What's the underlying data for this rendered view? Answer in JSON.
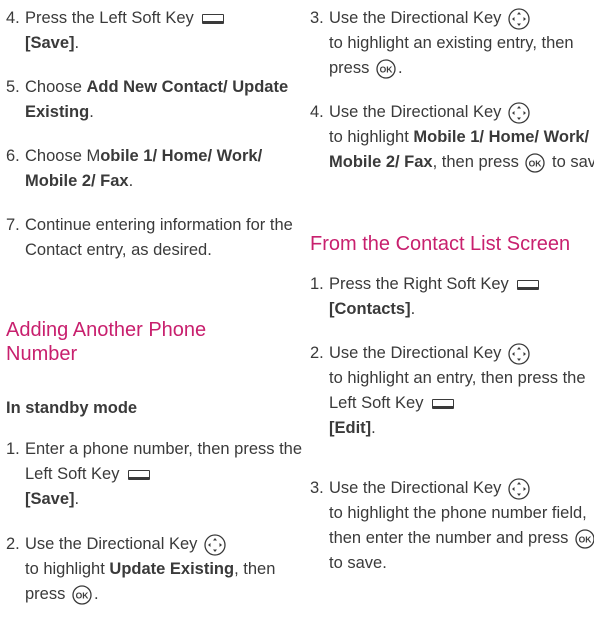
{
  "left": {
    "step4": {
      "num": "4.",
      "t1": "Press the Left Soft Key",
      "t2": "[Save]",
      "t3": "."
    },
    "step5": {
      "num": "5.",
      "t1": "Choose ",
      "t2": "Add New Contact/ Update Existing",
      "t3": "."
    },
    "step6": {
      "num": "6.",
      "t1": "Choose M",
      "t2": "obile 1/ Home/ Work/ Mobile 2/ Fax",
      "t3": "."
    },
    "step7": {
      "num": "7.",
      "t1": "Continue entering information for the Contact entry, as desired."
    },
    "heading": "Adding Another Phone Number",
    "subheading": "In standby mode",
    "a1": {
      "num": "1.",
      "t1": "Enter a phone number, then press the Left Soft Key",
      "t2": "[Save]",
      "t3": "."
    },
    "a2": {
      "num": "2.",
      "t1": "Use the Directional Key",
      "t2": "to highlight ",
      "t3": "Update Existing",
      "t4": ", then press",
      "t5": "."
    }
  },
  "right": {
    "s3": {
      "num": "3.",
      "t1": "Use the Directional Key",
      "t2": "to highlight an existing entry, then press",
      "t3": "."
    },
    "s4": {
      "num": "4.",
      "t1": "Use the Directional Key",
      "t2": "to highlight ",
      "t3": "Mobile 1/ Home/ Work/ Mobile 2/ Fax",
      "t4": ", then press",
      "t5": "to save."
    },
    "heading": "From the Contact List Screen",
    "b1": {
      "num": "1.",
      "t1": "Press the Right Soft Key",
      "t2": "[Contacts]",
      "t3": "."
    },
    "b2": {
      "num": "2.",
      "t1": "Use the Directional Key",
      "t2": "to highlight an entry, then press the Left Soft Key",
      "t3": "[Edit]",
      "t4": "."
    },
    "b3": {
      "num": "3.",
      "t1": "Use the Directional Key",
      "t2": "to highlight the phone number field, then enter the number and press",
      "t3": "to save."
    }
  },
  "icons": {
    "soft_key": "soft-key-icon",
    "directional": "directional-key-icon",
    "ok": "ok-key-icon"
  },
  "colors": {
    "heading": "#c8206e",
    "text": "#3a3a3a"
  }
}
